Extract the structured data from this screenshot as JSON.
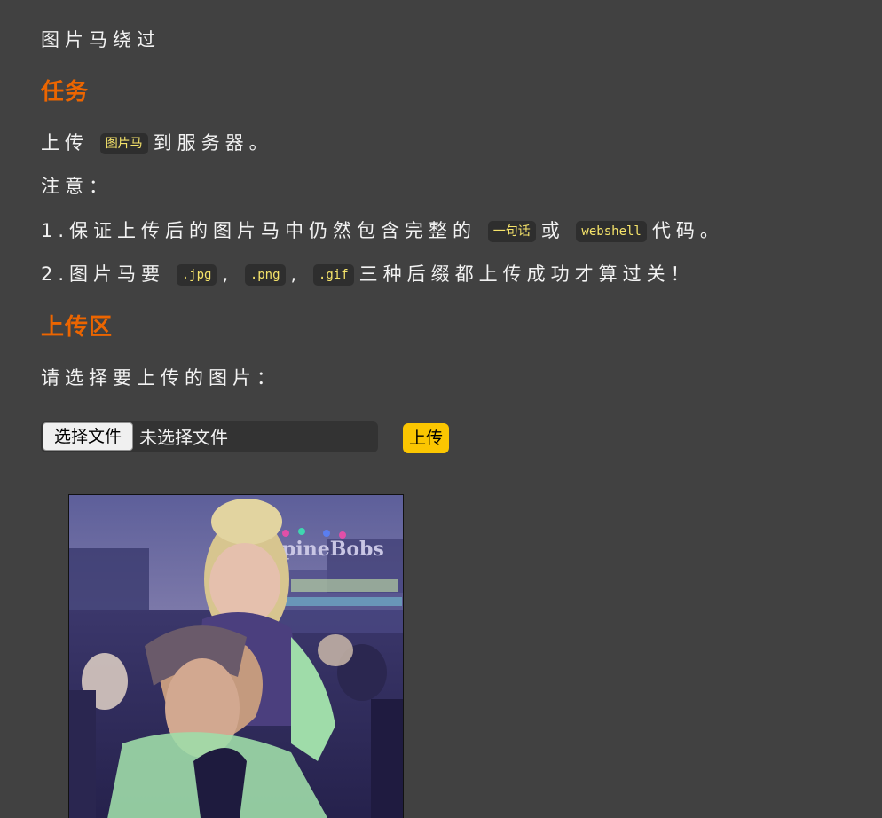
{
  "breadcrumb": "图片马绕过",
  "sections": {
    "task_title": "任务",
    "upload_title": "上传区"
  },
  "task": {
    "line1_pre": "上传",
    "line1_code": "图片马",
    "line1_post": "到服务器。",
    "note": "注意：",
    "item1_pre": "1.保证上传后的图片马中仍然包含完整的",
    "item1_code1": "一句话",
    "item1_mid": "或",
    "item1_code2": "webshell",
    "item1_post": "代码。",
    "item2_pre": "2.图片马要",
    "item2_code1": ".jpg",
    "item2_sep1": ",",
    "item2_code2": ".png",
    "item2_sep2": ",",
    "item2_code3": ".gif",
    "item2_post": "三种后缀都上传成功才算过关！"
  },
  "upload": {
    "prompt": "请选择要上传的图片：",
    "choose_label": "选择文件",
    "no_file_text": "未选择文件",
    "submit_label": "上传"
  },
  "preview_image": {
    "sign_text": "pineBobs"
  },
  "colors": {
    "background": "#414141",
    "heading": "#ec6500",
    "code_text": "#f5e36a",
    "code_bg": "#2e2e2e",
    "submit_bg": "#fbc601"
  }
}
